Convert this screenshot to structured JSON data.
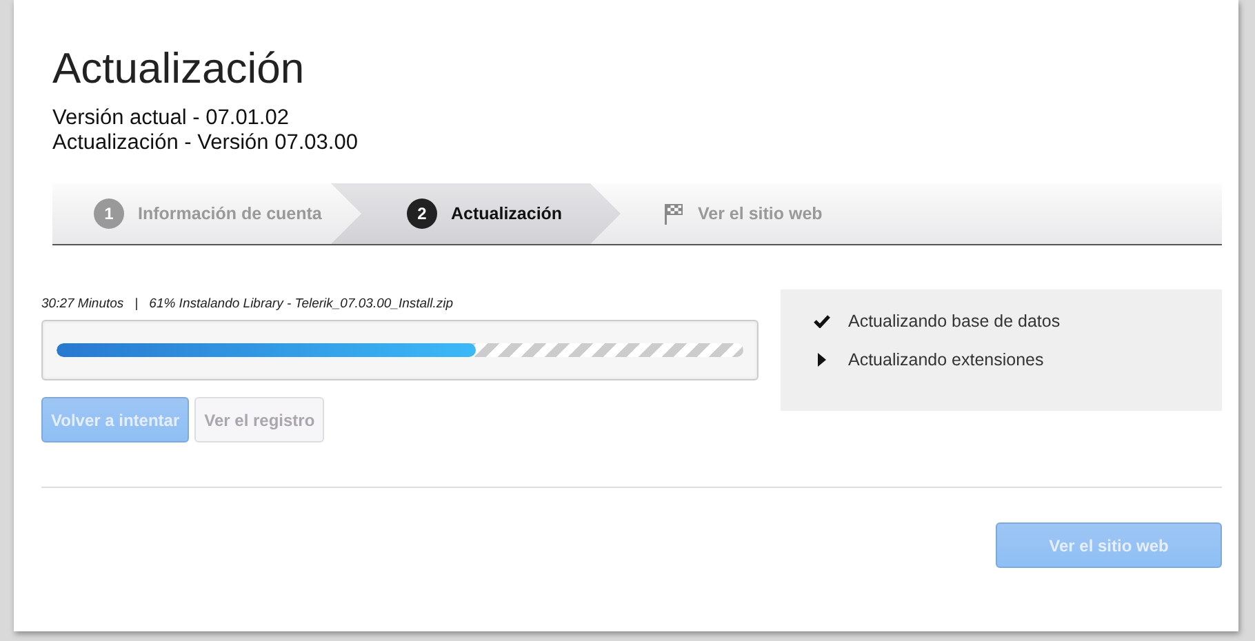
{
  "title": "Actualización",
  "versions": [
    "Versión actual - 07.01.02",
    "Actualización - Versión 07.03.00"
  ],
  "steps": [
    {
      "kind": "number",
      "number": "1",
      "label": "Información de cuenta",
      "selected": false
    },
    {
      "kind": "number",
      "number": "2",
      "label": "Actualización",
      "selected": true
    },
    {
      "kind": "flag",
      "label": "Ver el sitio web",
      "selected": false
    }
  ],
  "progress": {
    "time": "30:27 Minutos",
    "separator": "|",
    "message": "61% Instalando Library - Telerik_07.03.00_Install.zip",
    "level": 0.61
  },
  "actions": [
    {
      "label": "Volver a intentar",
      "kind": "primary",
      "disabled": true
    },
    {
      "label": "Ver el registro",
      "kind": "secondary",
      "disabled": true
    }
  ],
  "tasks": [
    {
      "label": "Actualizando base de datos",
      "done": true
    },
    {
      "label": "Actualizando extensiones",
      "done": false
    }
  ],
  "footer_button": {
    "label": "Ver el sitio web",
    "kind": "primary",
    "disabled": true
  }
}
